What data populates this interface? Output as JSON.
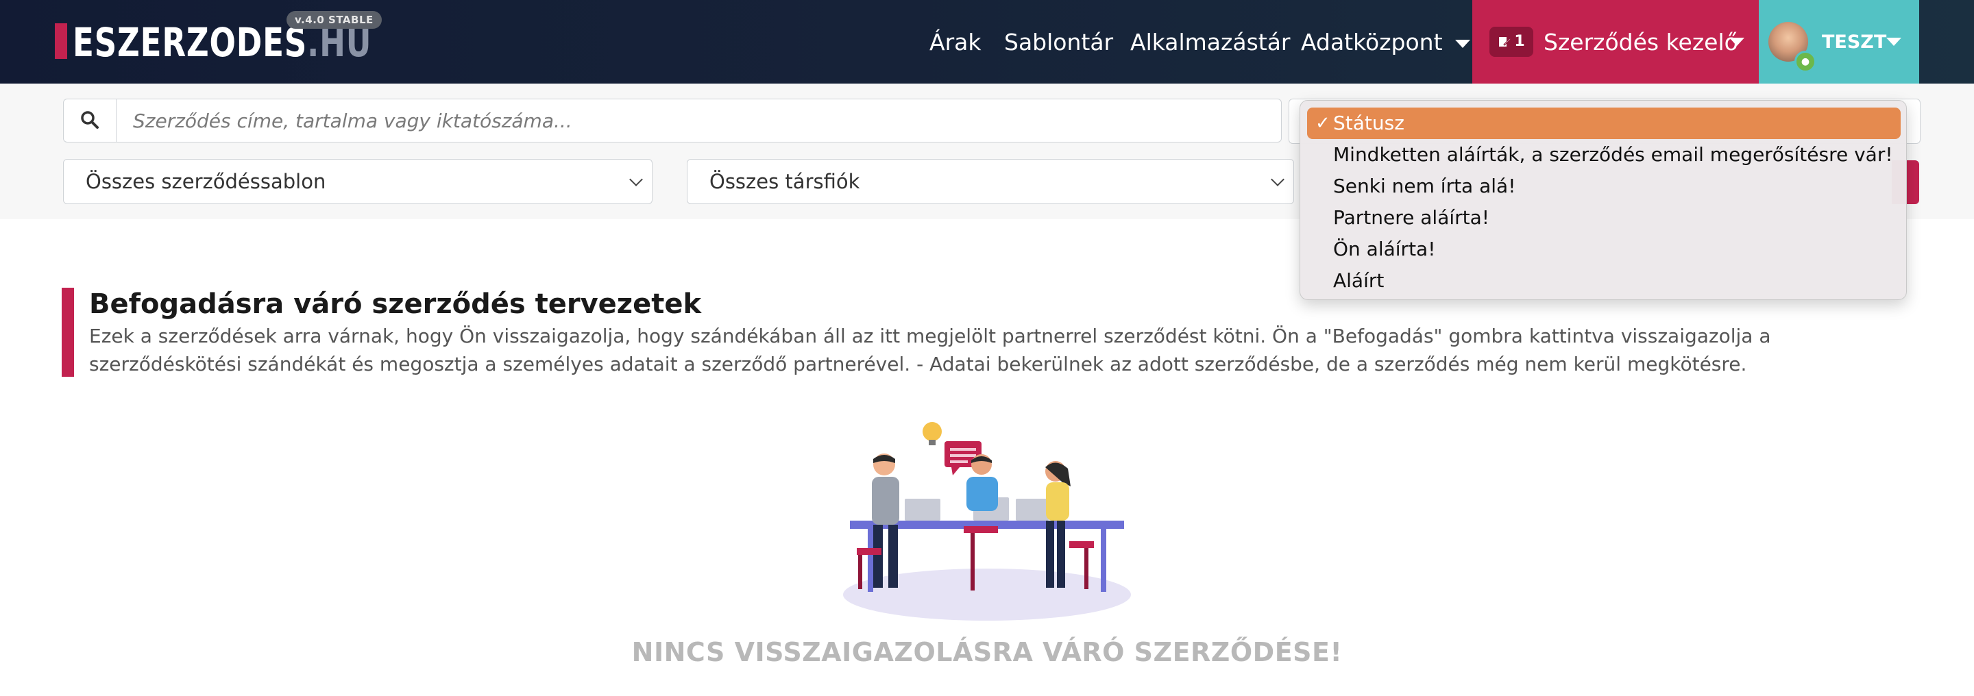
{
  "brand": {
    "logo_main": "ESZERZODES",
    "logo_tld": ".HU",
    "version": "v.4.0 STABLE"
  },
  "nav": {
    "items": [
      {
        "label": "Árak"
      },
      {
        "label": "Sablontár"
      },
      {
        "label": "Alkalmazástár"
      },
      {
        "label": "Adatközpont"
      }
    ],
    "contract_manager": {
      "badge_count": "1",
      "label": "Szerződés kezelő"
    },
    "user": {
      "name": "TESZT"
    }
  },
  "filters": {
    "search_placeholder": "Szerződés címe, tartalma vagy iktatószáma...",
    "template_select": "Összes szerződéssablon",
    "account_select": "Összes társfiók",
    "status_dropdown": {
      "options": [
        {
          "label": "Státusz",
          "selected": true
        },
        {
          "label": "Mindketten aláírták, a szerződés email megerősítésre vár!",
          "selected": false
        },
        {
          "label": "Senki nem írta alá!",
          "selected": false
        },
        {
          "label": "Partnere aláírta!",
          "selected": false
        },
        {
          "label": "Ön aláírta!",
          "selected": false
        },
        {
          "label": "Aláírt",
          "selected": false
        }
      ]
    }
  },
  "section": {
    "title": "Befogadásra váró szerződés tervezetek",
    "description": "Ezek a szerződések arra várnak, hogy Ön visszaigazolja, hogy szándékában áll az itt megjelölt partnerrel szerződést kötni. Ön a \"Befogadás\" gombra kattintva visszaigazolja a szerződéskötési szándékát és megosztja a személyes adatait a szerződő partnerével. - Adatai bekerülnek az adott szerződésbe, de a szerződés még nem kerül megkötésre.",
    "empty_message": "NINCS VISSZAIGAZOLÁSRA VÁRÓ SZERZŐDÉSE!"
  },
  "colors": {
    "brand_red": "#c2224f",
    "teal": "#53c2c4",
    "dropdown_selected": "#e58a4f",
    "header_dark": "#121b34"
  }
}
